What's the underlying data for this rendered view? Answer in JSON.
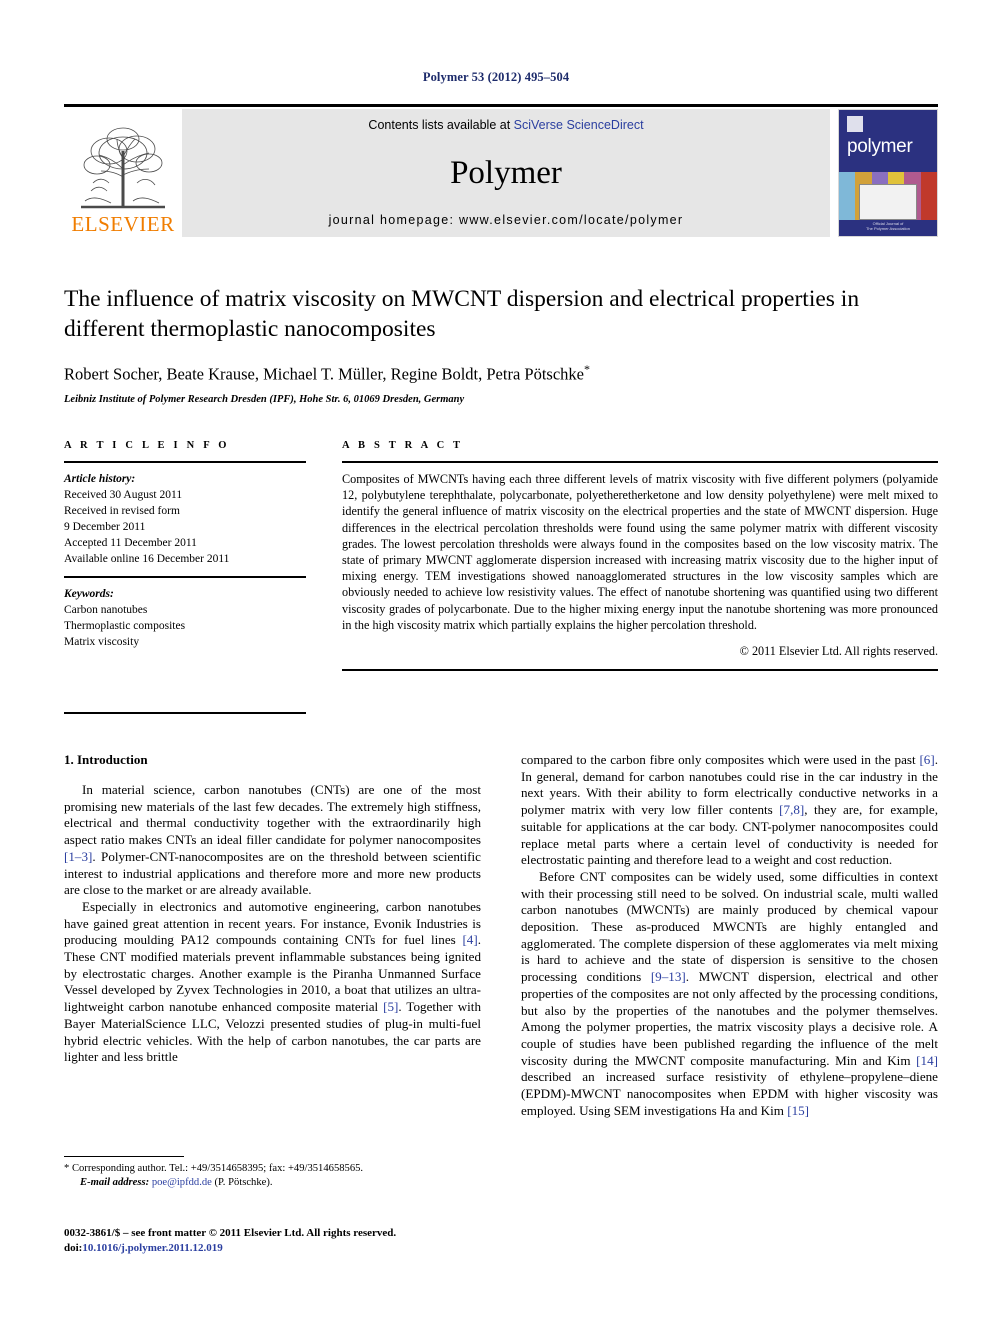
{
  "running_head": "Polymer 53 (2012) 495–504",
  "masthead": {
    "contents_prefix": "Contents lists available at ",
    "contents_link": "SciVerse ScienceDirect",
    "journal_title": "Polymer",
    "homepage": "journal homepage: www.elsevier.com/locate/polymer",
    "publisher_logo_text": "ELSEVIER",
    "cover_title": "polymer",
    "cover_footer_line1": "Official Journal of",
    "cover_footer_line2": "The Polymer Association"
  },
  "article": {
    "title": "The influence of matrix viscosity on MWCNT dispersion and electrical properties in different thermoplastic nanocomposites",
    "authors": "Robert Socher, Beate Krause, Michael T. Müller, Regine Boldt, Petra Pötschke",
    "corresponding_marker": "*",
    "affiliation": "Leibniz Institute of Polymer Research Dresden (IPF), Hohe Str. 6, 01069 Dresden, Germany"
  },
  "article_info": {
    "heading": "A R T I C L E   I N F O",
    "history_label": "Article history:",
    "history": [
      "Received 30 August 2011",
      "Received in revised form",
      "9 December 2011",
      "Accepted 11 December 2011",
      "Available online 16 December 2011"
    ],
    "keywords_label": "Keywords:",
    "keywords": [
      "Carbon nanotubes",
      "Thermoplastic composites",
      "Matrix viscosity"
    ]
  },
  "abstract": {
    "heading": "A B S T R A C T",
    "text": "Composites of MWCNTs having each three different levels of matrix viscosity with five different polymers (polyamide 12, polybutylene terephthalate, polycarbonate, polyetheretherketone and low density polyethylene) were melt mixed to identify the general influence of matrix viscosity on the electrical properties and the state of MWCNT dispersion. Huge differences in the electrical percolation thresholds were found using the same polymer matrix with different viscosity grades. The lowest percolation thresholds were always found in the composites based on the low viscosity matrix. The state of primary MWCNT agglomerate dispersion increased with increasing matrix viscosity due to the higher input of mixing energy. TEM investigations showed nanoagglomerated structures in the low viscosity samples which are obviously needed to achieve low resistivity values. The effect of nanotube shortening was quantified using two different viscosity grades of polycarbonate. Due to the higher mixing energy input the nanotube shortening was more pronounced in the high viscosity matrix which partially explains the higher percolation threshold.",
    "copyright": "© 2011 Elsevier Ltd. All rights reserved."
  },
  "body": {
    "section_heading": "1. Introduction",
    "left_paragraphs": [
      "In material science, carbon nanotubes (CNTs) are one of the most promising new materials of the last few decades. The extremely high stiffness, electrical and thermal conductivity together with the extraordinarily high aspect ratio makes CNTs an ideal filler candidate for polymer nanocomposites [1–3]. Polymer-CNT-nanocomposites are on the threshold between scientific interest to industrial applications and therefore more and more new products are close to the market or are already available.",
      "Especially in electronics and automotive engineering, carbon nanotubes have gained great attention in recent years. For instance, Evonik Industries is producing moulding PA12 compounds containing CNTs for fuel lines [4]. These CNT modified materials prevent inflammable substances being ignited by electrostatic charges. Another example is the Piranha Unmanned Surface Vessel developed by Zyvex Technologies in 2010, a boat that utilizes an ultra-lightweight carbon nanotube enhanced composite material [5]. Together with Bayer MaterialScience LLC, Velozzi presented studies of plug-in multi-fuel hybrid electric vehicles. With the help of carbon nanotubes, the car parts are lighter and less brittle"
    ],
    "right_paragraphs": [
      "compared to the carbon fibre only composites which were used in the past [6]. In general, demand for carbon nanotubes could rise in the car industry in the next years. With their ability to form electrically conductive networks in a polymer matrix with very low filler contents [7,8], they are, for example, suitable for applications at the car body. CNT-polymer nanocomposites could replace metal parts where a certain level of conductivity is needed for electrostatic painting and therefore lead to a weight and cost reduction.",
      "Before CNT composites can be widely used, some difficulties in context with their processing still need to be solved. On industrial scale, multi walled carbon nanotubes (MWCNTs) are mainly produced by chemical vapour deposition. These as-produced MWCNTs are highly entangled and agglomerated. The complete dispersion of these agglomerates via melt mixing is hard to achieve and the state of dispersion is sensitive to the chosen processing conditions [9–13]. MWCNT dispersion, electrical and other properties of the composites are not only affected by the processing conditions, but also by the properties of the nanotubes and the polymer themselves. Among the polymer properties, the matrix viscosity plays a decisive role. A couple of studies have been published regarding the influence of the melt viscosity during the MWCNT composite manufacturing. Min and Kim [14] described an increased surface resistivity of ethylene–propylene–diene (EPDM)-MWCNT nanocomposites when EPDM with higher viscosity was employed. Using SEM investigations Ha and Kim [15]"
    ]
  },
  "footnote": {
    "line1": "* Corresponding author. Tel.: +49/3514658395; fax: +49/3514658565.",
    "email_label": "E-mail address:",
    "email": "poe@ipfdd.de",
    "email_suffix": "(P. Pötschke)."
  },
  "footer": {
    "line1": "0032-3861/$ – see front matter © 2011 Elsevier Ltd. All rights reserved.",
    "doi_label": "doi:",
    "doi": "10.1016/j.polymer.2011.12.019"
  },
  "colors": {
    "link": "#2b3fa0",
    "running_head": "#1d2b6b",
    "elsevier_orange": "#f07d00",
    "masthead_grey": "#e6e6e6",
    "cover_blue": "#2b3180"
  }
}
